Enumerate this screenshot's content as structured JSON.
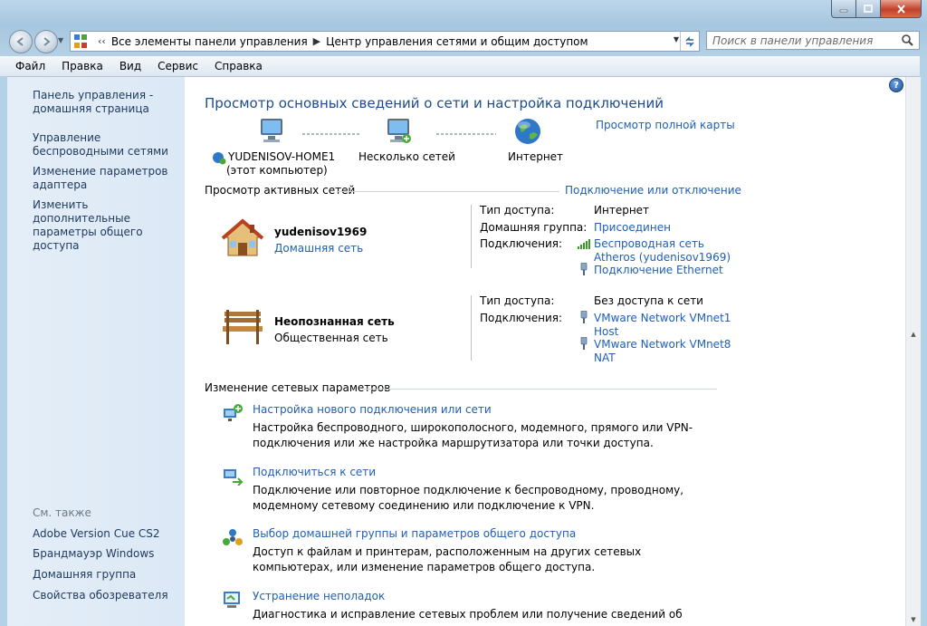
{
  "address": {
    "back_glyph": "‹‹",
    "crumb1": "Все элементы панели управления",
    "crumb2": "Центр управления сетями и общим доступом"
  },
  "search": {
    "placeholder": "Поиск в панели управления"
  },
  "menu": [
    "Файл",
    "Правка",
    "Вид",
    "Сервис",
    "Справка"
  ],
  "sidebar": {
    "home": "Панель управления - домашняя страница",
    "links": [
      "Управление беспроводными сетями",
      "Изменение параметров адаптера",
      "Изменить дополнительные параметры общего доступа"
    ],
    "see_also_title": "См. также",
    "see_also": [
      "Adobe Version Cue CS2",
      "Брандмауэр Windows",
      "Домашняя группа",
      "Свойства обозревателя"
    ]
  },
  "main": {
    "title": "Просмотр основных сведений о сети и настройка подключений",
    "full_map": "Просмотр полной карты",
    "map": {
      "computer": "YUDENISOV-HOME1",
      "computer_sub": "(этот компьютер)",
      "networks": "Несколько сетей",
      "internet": "Интернет"
    },
    "active_title": "Просмотр активных сетей",
    "connect_link": "Подключение или отключение",
    "net1": {
      "name": "yudenisov1969",
      "type": "Домашняя сеть",
      "access_label": "Тип доступа:",
      "access_value": "Интернет",
      "homegroup_label": "Домашняя группа:",
      "homegroup_value": "Присоединен",
      "conn_label": "Подключения:",
      "conn1": "Беспроводная сеть",
      "conn1b": "Atheros (yudenisov1969)",
      "conn2": "Подключение Ethernet"
    },
    "net2": {
      "name": "Неопознанная сеть",
      "type": "Общественная сеть",
      "access_label": "Тип доступа:",
      "access_value": "Без доступа к сети",
      "conn_label": "Подключения:",
      "conn1": "VMware Network VMnet1",
      "conn1b": "Host",
      "conn2": "VMware Network VMnet8",
      "conn2b": "NAT"
    },
    "change_title": "Изменение сетевых параметров",
    "tasks": [
      {
        "title": "Настройка нового подключения или сети",
        "desc": "Настройка беспроводного, широкополосного, модемного, прямого или VPN-подключения или же настройка маршрутизатора или точки доступа."
      },
      {
        "title": "Подключиться к сети",
        "desc": "Подключение или повторное подключение к беспроводному, проводному, модемному сетевому соединению или подключение к VPN."
      },
      {
        "title": "Выбор домашней группы и параметров общего доступа",
        "desc": "Доступ к файлам и принтерам, расположенным на других сетевых компьютерах, или изменение параметров общего доступа."
      },
      {
        "title": "Устранение неполадок",
        "desc": "Диагностика и исправление сетевых проблем или получение сведений об исправлении."
      }
    ]
  }
}
